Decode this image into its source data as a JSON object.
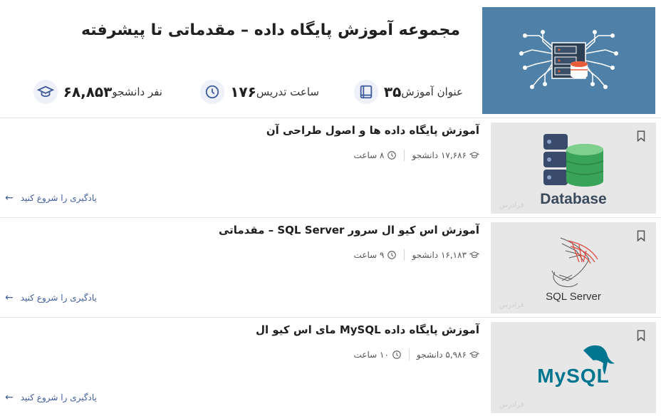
{
  "collection": {
    "title": "مجموعه آموزش پایگاه داده – مقدماتی تا پیشرفته",
    "stats": [
      {
        "icon": "book-icon",
        "value": "۳۵",
        "label": "عنوان آموزش"
      },
      {
        "icon": "clock-icon",
        "value": "۱۷۶",
        "label": "ساعت تدریس"
      },
      {
        "icon": "graduation-cap-icon",
        "value": "۶۸,۸۵۳",
        "label": "نفر دانشجو"
      }
    ]
  },
  "courses": [
    {
      "title": "آموزش پایگاه داده ها و اصول طراحی آن",
      "students": "۱۷,۶۸۶ دانشجو",
      "hours": "۸ ساعت",
      "thumb_label": "Database",
      "watermark": "فرادرس",
      "cta": "یادگیری را شروع کنید"
    },
    {
      "title": "آموزش اس کیو ال سرور SQL Server – مقدماتی",
      "students": "۱۶,۱۸۳ دانشجو",
      "hours": "۹ ساعت",
      "thumb_label": "SQL Server",
      "watermark": "فرادرس",
      "cta": "یادگیری را شروع کنید"
    },
    {
      "title": "آموزش پایگاه داده MySQL مای اس کیو ال",
      "students": "۵,۹۸۶ دانشجو",
      "hours": "۱۰ ساعت",
      "thumb_label": "MySQL",
      "watermark": "فرادرس",
      "cta": "یادگیری را شروع کنید"
    }
  ],
  "colors": {
    "hero_bg": "#4f80a7",
    "accent_blue": "#3f5d9b",
    "icon_bg": "#eef1f8",
    "mysql_blue": "#00758f",
    "mysql_orange": "#f29111"
  }
}
